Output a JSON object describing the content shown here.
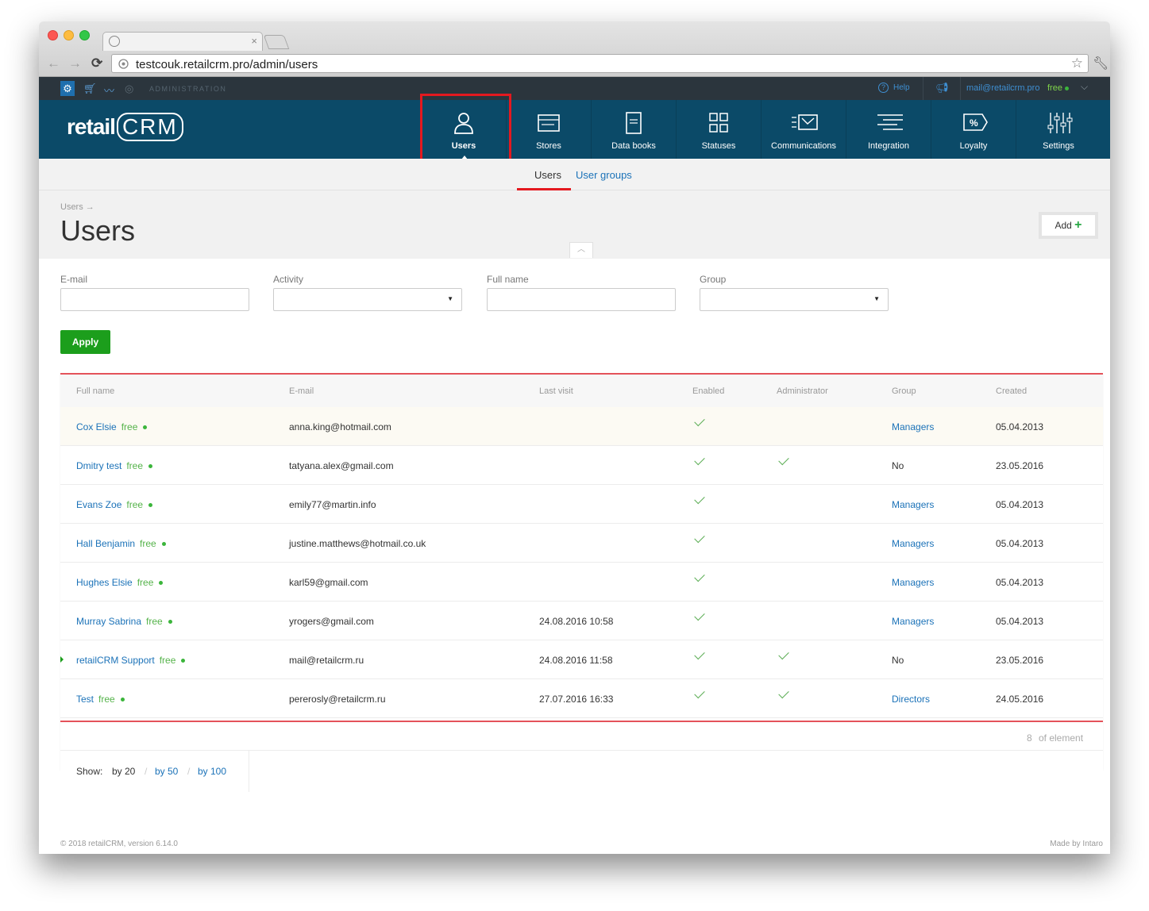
{
  "browser": {
    "url": "testcouk.retailcrm.pro/admin/users",
    "tab_close": "×"
  },
  "adminbar": {
    "label": "ADMINISTRATION",
    "help": "Help",
    "user_email": "mail@retailcrm.pro",
    "user_plan": "free"
  },
  "brand": {
    "logo_left": "retail",
    "logo_right": "CRM"
  },
  "menu": [
    {
      "label": "Users",
      "icon": "user-icon"
    },
    {
      "label": "Stores",
      "icon": "store-icon"
    },
    {
      "label": "Data books",
      "icon": "book-icon"
    },
    {
      "label": "Statuses",
      "icon": "statuses-icon"
    },
    {
      "label": "Communications",
      "icon": "mail-icon"
    },
    {
      "label": "Integration",
      "icon": "integration-icon"
    },
    {
      "label": "Loyalty",
      "icon": "loyalty-icon"
    },
    {
      "label": "Settings",
      "icon": "sliders-icon"
    }
  ],
  "subnav": {
    "users": "Users",
    "user_groups": "User groups"
  },
  "page": {
    "breadcrumb": "Users →",
    "title": "Users",
    "add_label": "Add"
  },
  "filters": {
    "email_label": "E-mail",
    "activity_label": "Activity",
    "fullname_label": "Full name",
    "group_label": "Group",
    "apply_label": "Apply"
  },
  "table": {
    "headers": [
      "Full name",
      "E-mail",
      "Last visit",
      "Enabled",
      "Administrator",
      "Group",
      "Created"
    ],
    "rows": [
      {
        "name": "Cox Elsie",
        "plan": "free",
        "email": "anna.king@hotmail.com",
        "last_visit": "",
        "enabled": true,
        "admin": false,
        "group": "Managers",
        "created": "05.04.2013"
      },
      {
        "name": "Dmitry test",
        "plan": "free",
        "email": "tatyana.alex@gmail.com",
        "last_visit": "",
        "enabled": true,
        "admin": true,
        "group": "No",
        "created": "23.05.2016"
      },
      {
        "name": "Evans Zoe",
        "plan": "free",
        "email": "emily77@martin.info",
        "last_visit": "",
        "enabled": true,
        "admin": false,
        "group": "Managers",
        "created": "05.04.2013"
      },
      {
        "name": "Hall Benjamin",
        "plan": "free",
        "email": "justine.matthews@hotmail.co.uk",
        "last_visit": "",
        "enabled": true,
        "admin": false,
        "group": "Managers",
        "created": "05.04.2013"
      },
      {
        "name": "Hughes Elsie",
        "plan": "free",
        "email": "karl59@gmail.com",
        "last_visit": "",
        "enabled": true,
        "admin": false,
        "group": "Managers",
        "created": "05.04.2013"
      },
      {
        "name": "Murray Sabrina",
        "plan": "free",
        "email": "yrogers@gmail.com",
        "last_visit": "24.08.2016 10:58",
        "enabled": true,
        "admin": false,
        "group": "Managers",
        "created": "05.04.2013"
      },
      {
        "name": "retailCRM Support",
        "plan": "free",
        "email": "mail@retailcrm.ru",
        "last_visit": "24.08.2016 11:58",
        "enabled": true,
        "admin": true,
        "group": "No",
        "created": "23.05.2016"
      },
      {
        "name": "Test",
        "plan": "free",
        "email": "pererosly@retailcrm.ru",
        "last_visit": "27.07.2016 16:33",
        "enabled": true,
        "admin": true,
        "group": "Directors",
        "created": "24.05.2016"
      }
    ],
    "count": "8",
    "count_suffix": "of element"
  },
  "pager": {
    "show_label": "Show:",
    "options": [
      "by 20",
      "by 50",
      "by 100"
    ],
    "separator": "/"
  },
  "footer": {
    "copyright": "© 2018 retailCRM, version 6.14.0",
    "made_by": "Made by Intaro"
  },
  "colors": {
    "header": "#0b4a68",
    "accent_red": "#e4525a",
    "link": "#1b72b8",
    "apply": "#1c9e1c"
  }
}
